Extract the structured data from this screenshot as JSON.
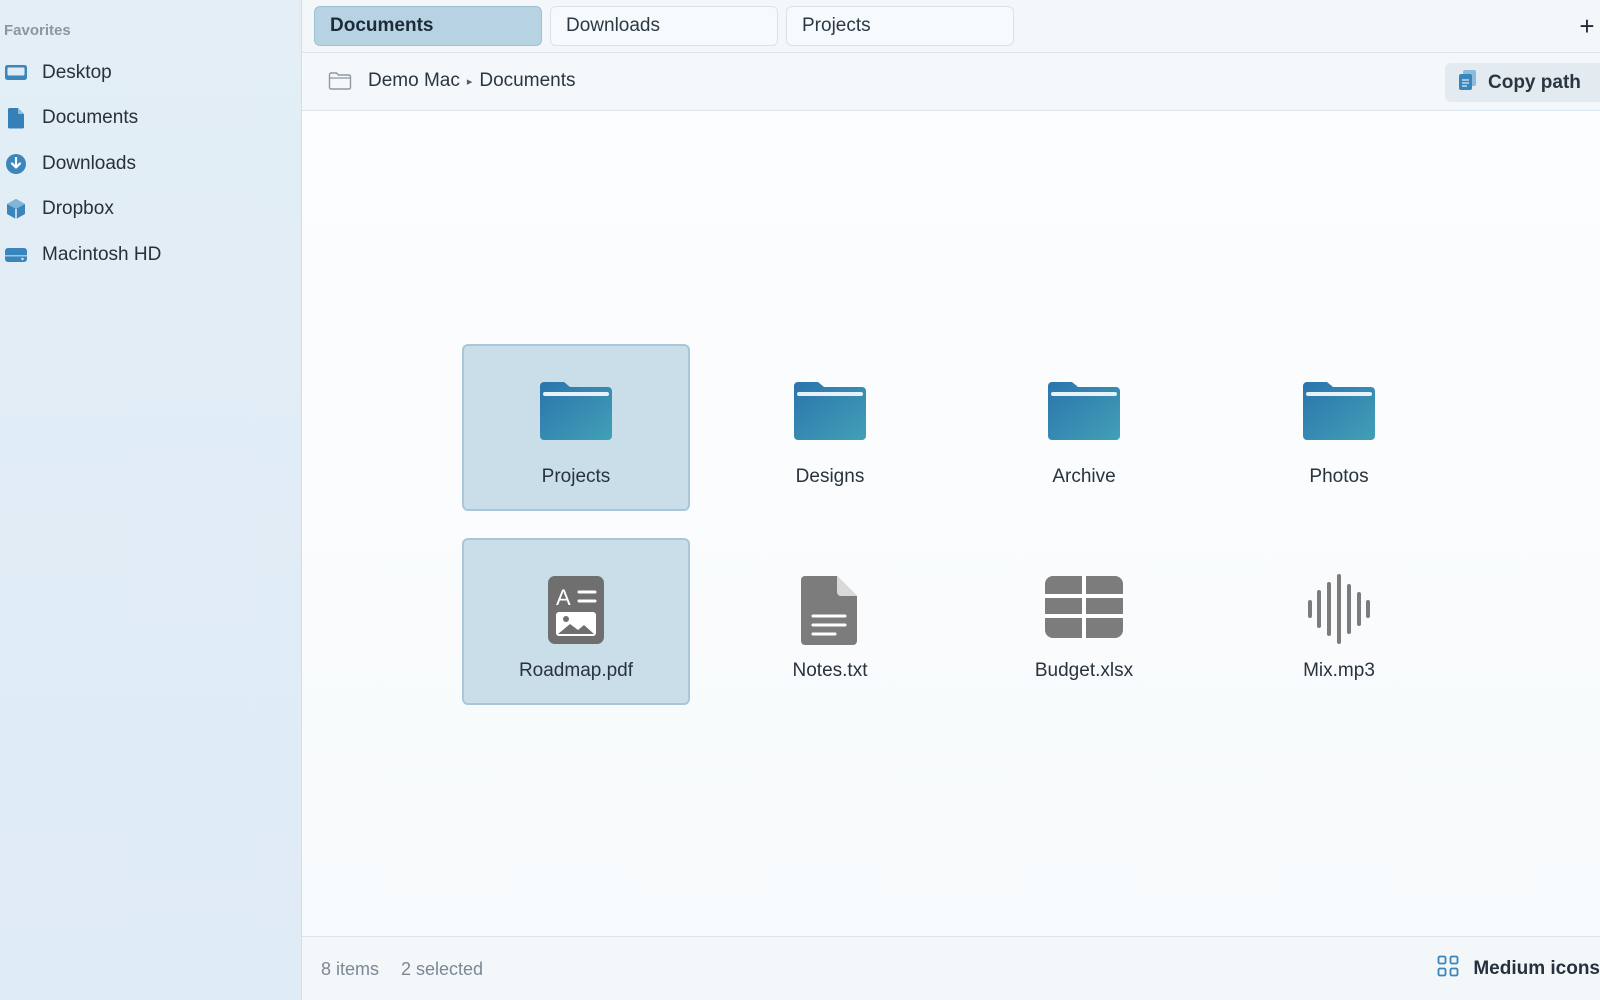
{
  "colors": {
    "accent": "#2f7fb6",
    "folder_top": "#2a78b0",
    "folder_bottom": "#3f9db5",
    "file_gray": "#7d7d7d",
    "selection": "#cadeea"
  },
  "sidebar": {
    "section_title": "Favorites",
    "items": [
      {
        "label": "Desktop",
        "icon": "desktop-icon"
      },
      {
        "label": "Documents",
        "icon": "document-icon"
      },
      {
        "label": "Downloads",
        "icon": "download-icon"
      },
      {
        "label": "Dropbox",
        "icon": "dropbox-icon"
      },
      {
        "label": "Macintosh HD",
        "icon": "hard-drive-icon"
      }
    ]
  },
  "tabs": [
    {
      "label": "Documents",
      "active": true
    },
    {
      "label": "Downloads",
      "active": false
    },
    {
      "label": "Projects",
      "active": false
    }
  ],
  "tab_add_label": "+",
  "pathbar": {
    "breadcrumb": [
      "Demo Mac",
      "Documents"
    ],
    "separator": "▸",
    "copy_label": "Copy path"
  },
  "files": [
    {
      "name": "Projects",
      "kind": "folder",
      "selected": true
    },
    {
      "name": "Designs",
      "kind": "folder",
      "selected": false
    },
    {
      "name": "Archive",
      "kind": "folder",
      "selected": false
    },
    {
      "name": "Photos",
      "kind": "folder",
      "selected": false
    },
    {
      "name": "Roadmap.pdf",
      "kind": "pdf",
      "selected": true
    },
    {
      "name": "Notes.txt",
      "kind": "text",
      "selected": false
    },
    {
      "name": "Budget.xlsx",
      "kind": "spreadsheet",
      "selected": false
    },
    {
      "name": "Mix.mp3",
      "kind": "audio",
      "selected": false
    }
  ],
  "status": {
    "items_count": "8 items",
    "selected_count": "2 selected",
    "view_mode_label": "Medium icons"
  }
}
